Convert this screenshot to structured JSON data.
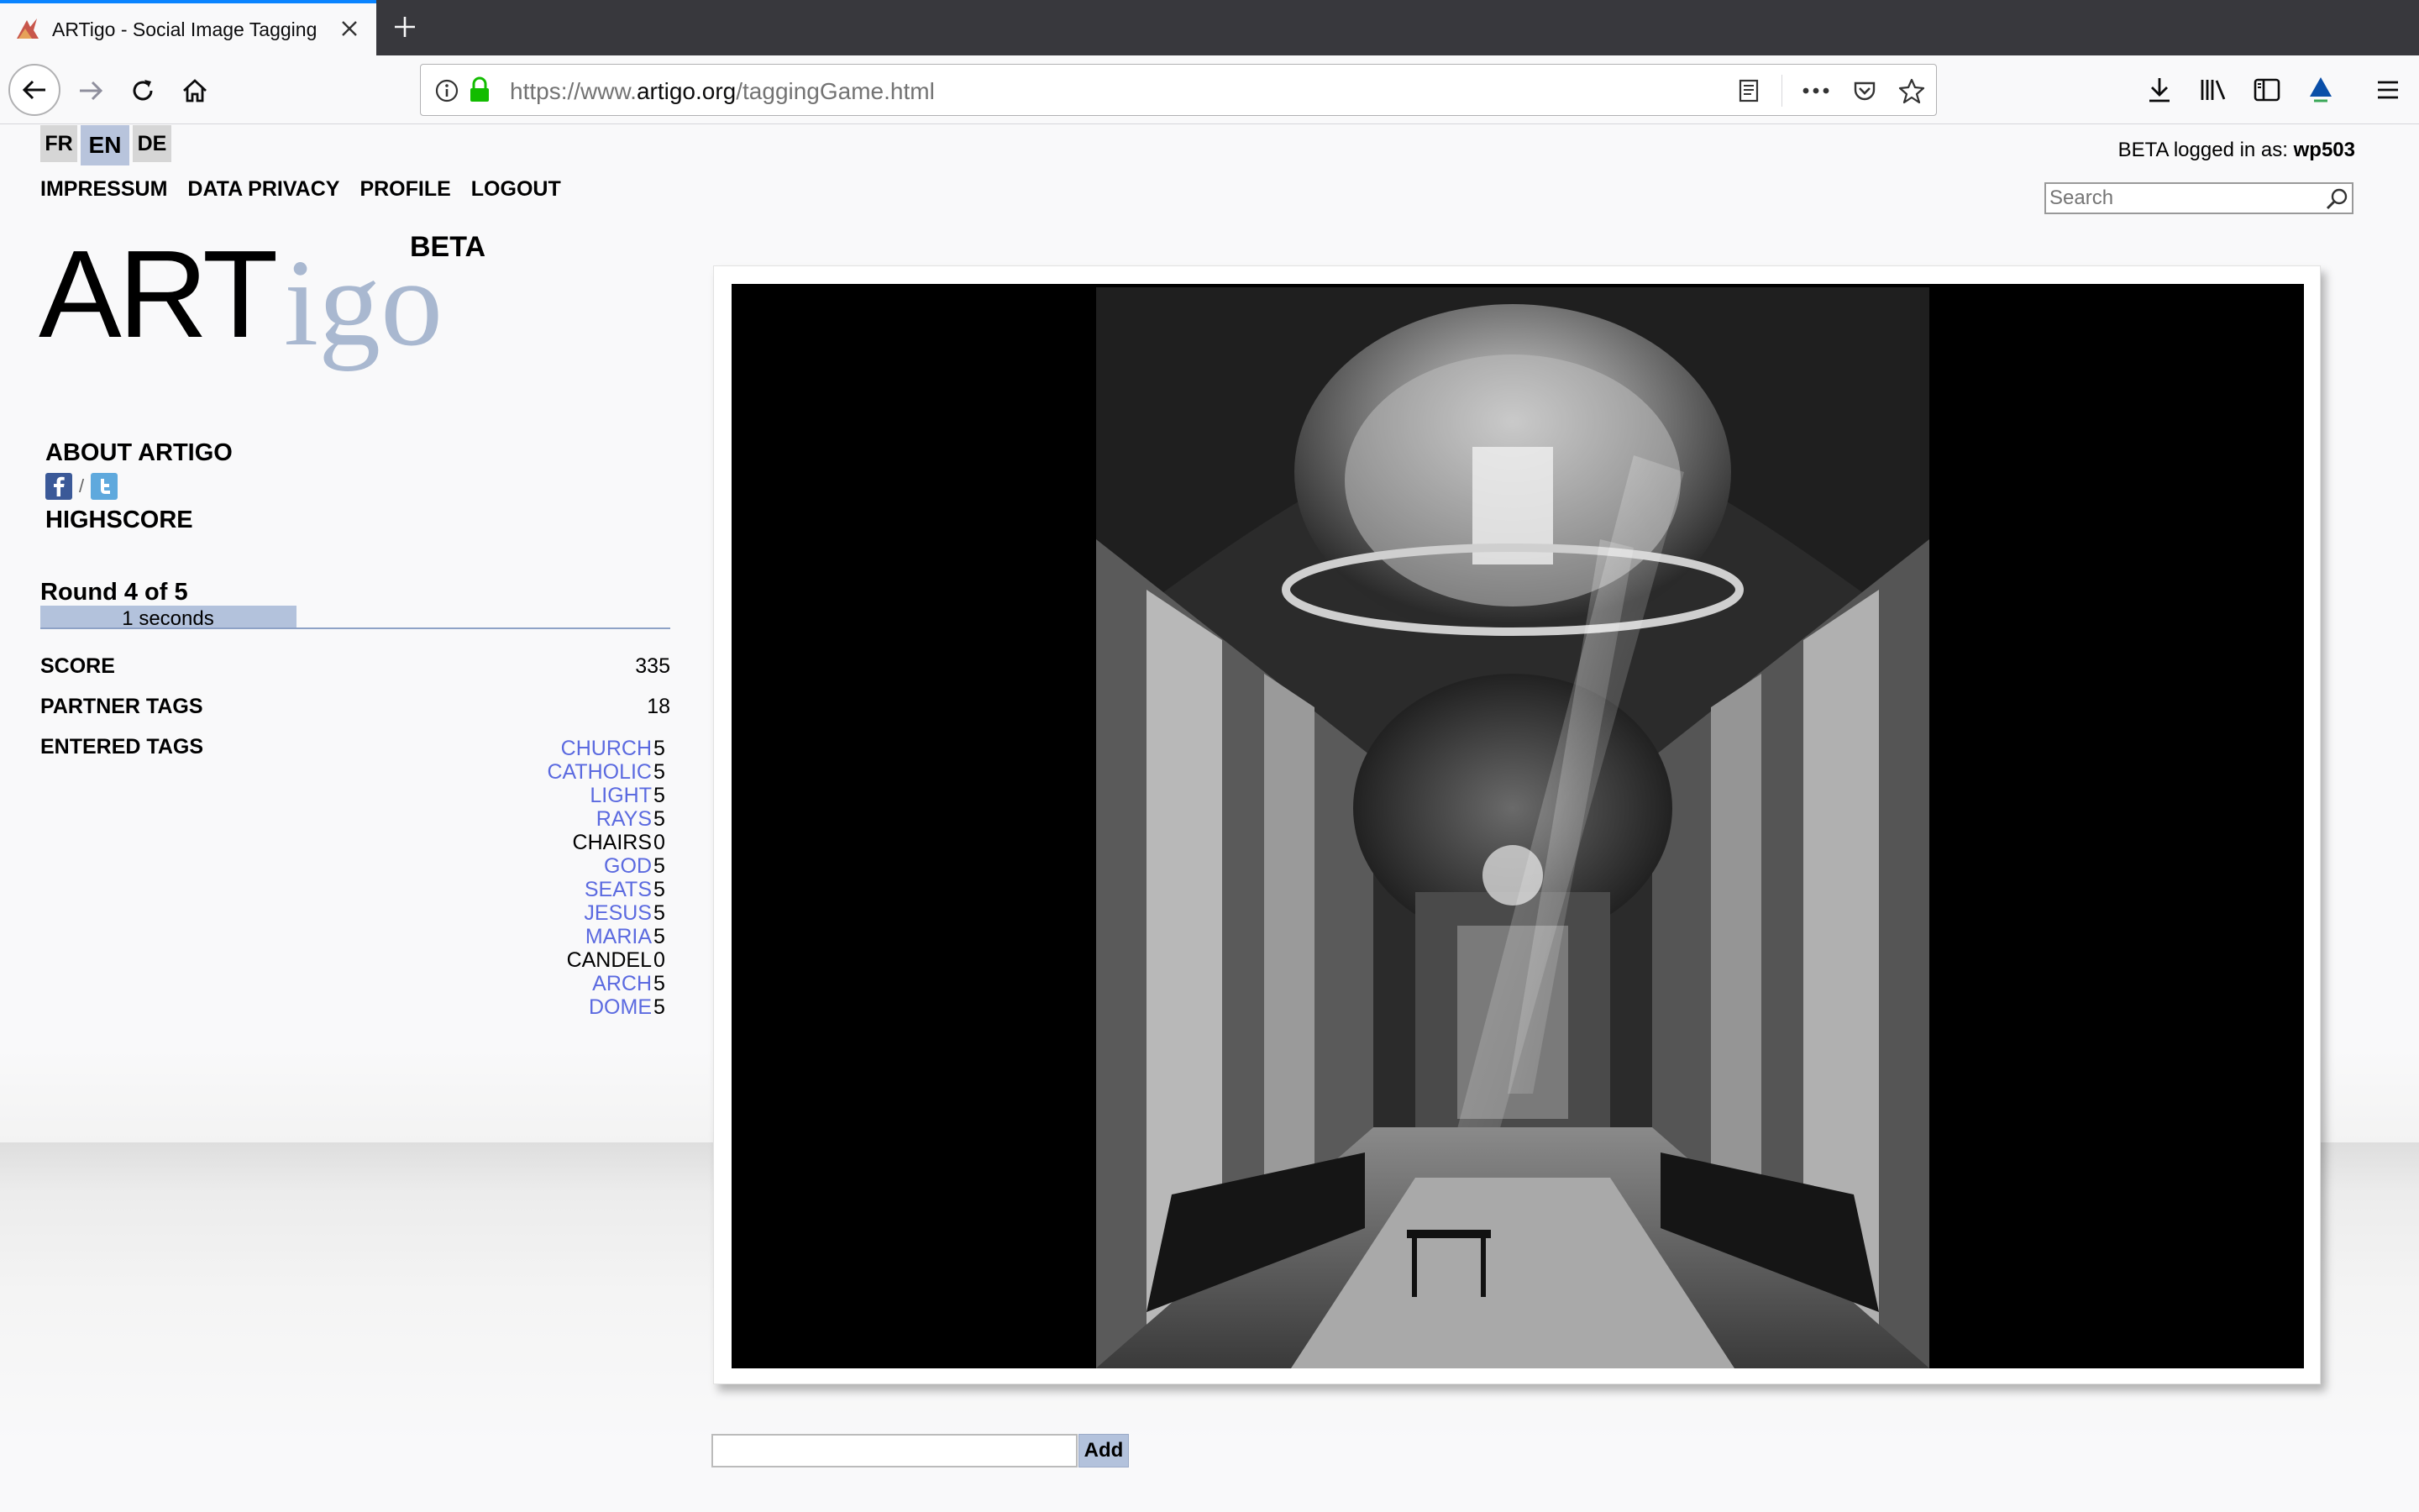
{
  "browser": {
    "tab_title": "ARTigo - Social Image Tagging",
    "url_prefix": "https://www.",
    "url_host": "artigo.org",
    "url_path": "/taggingGame.html"
  },
  "languages": [
    {
      "code": "FR",
      "active": false
    },
    {
      "code": "EN",
      "active": true
    },
    {
      "code": "DE",
      "active": false
    }
  ],
  "topnav": [
    "IMPRESSUM",
    "DATA PRIVACY",
    "PROFILE",
    "LOGOUT"
  ],
  "account": {
    "status_prefix": "BETA logged in as:",
    "username": "wp503"
  },
  "search": {
    "placeholder": "Search"
  },
  "logo": {
    "art": "ART",
    "igo": "igo",
    "beta": "BETA"
  },
  "sidebar": {
    "about": "ABOUT ARTIGO",
    "social_separator": "/",
    "highscore": "HIGHSCORE"
  },
  "game": {
    "round_label": "Round 4 of 5",
    "timer_text": "1 seconds",
    "timer_fraction": 0.22,
    "score_label": "SCORE",
    "score_value": "335",
    "partner_tags_label": "PARTNER TAGS",
    "partner_tags_value": "18",
    "entered_tags_label": "ENTERED TAGS",
    "entered_tags": [
      {
        "tag": "CHURCH",
        "points": "5"
      },
      {
        "tag": "CATHOLIC",
        "points": "5"
      },
      {
        "tag": "LIGHT",
        "points": "5"
      },
      {
        "tag": "RAYS",
        "points": "5"
      },
      {
        "tag": "CHAIRS",
        "points": "0"
      },
      {
        "tag": "GOD",
        "points": "5"
      },
      {
        "tag": "SEATS",
        "points": "5"
      },
      {
        "tag": "JESUS",
        "points": "5"
      },
      {
        "tag": "MARIA",
        "points": "5"
      },
      {
        "tag": "CANDEL",
        "points": "0"
      },
      {
        "tag": "ARCH",
        "points": "5"
      },
      {
        "tag": "DOME",
        "points": "5"
      }
    ],
    "add_button": "Add",
    "tag_input_value": ""
  },
  "colors": {
    "accent": "#0a84ff",
    "tag_positive": "#5b6ae0",
    "timer_fill": "#b3c2dc",
    "logo_igo": "#a9b8d0"
  },
  "icons": {
    "facebook": "facebook-icon",
    "twitter": "twitter-icon",
    "search": "magnifier-icon"
  }
}
